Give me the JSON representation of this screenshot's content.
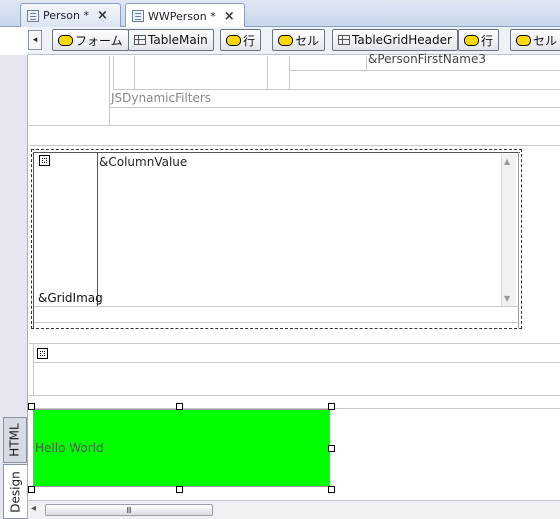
{
  "tabs": [
    {
      "title": "Person *",
      "close": "×",
      "active": false
    },
    {
      "title": "WWPerson *",
      "close": "×",
      "active": true
    }
  ],
  "toolbar": {
    "scroll_left": "◂",
    "buttons": [
      {
        "label": "フォーム",
        "icon": "pill-icon"
      },
      {
        "label": "TableMain",
        "icon": "table-icon"
      },
      {
        "label": "行",
        "icon": "pill-icon"
      },
      {
        "label": "セル",
        "icon": "pill-icon"
      },
      {
        "label": "TableGridHeader",
        "icon": "table-icon"
      },
      {
        "label": "行",
        "icon": "pill-icon"
      },
      {
        "label": "セル",
        "icon": "pill-icon"
      }
    ]
  },
  "design": {
    "first_name_var": "&PersonFirstName3",
    "dynamic_filters": "JSDynamicFilters",
    "column_value": "&ColumnValue",
    "grid_image": "&GridImag",
    "hello_world": "Hello World",
    "hello_world_bg": "#00ff00"
  },
  "side_tabs": [
    {
      "label": "HTML",
      "active": false
    },
    {
      "label": "Design",
      "active": true
    }
  ],
  "scrollbar": {
    "left_arrow": "◂",
    "thumb_grip": "Ⅲ"
  }
}
